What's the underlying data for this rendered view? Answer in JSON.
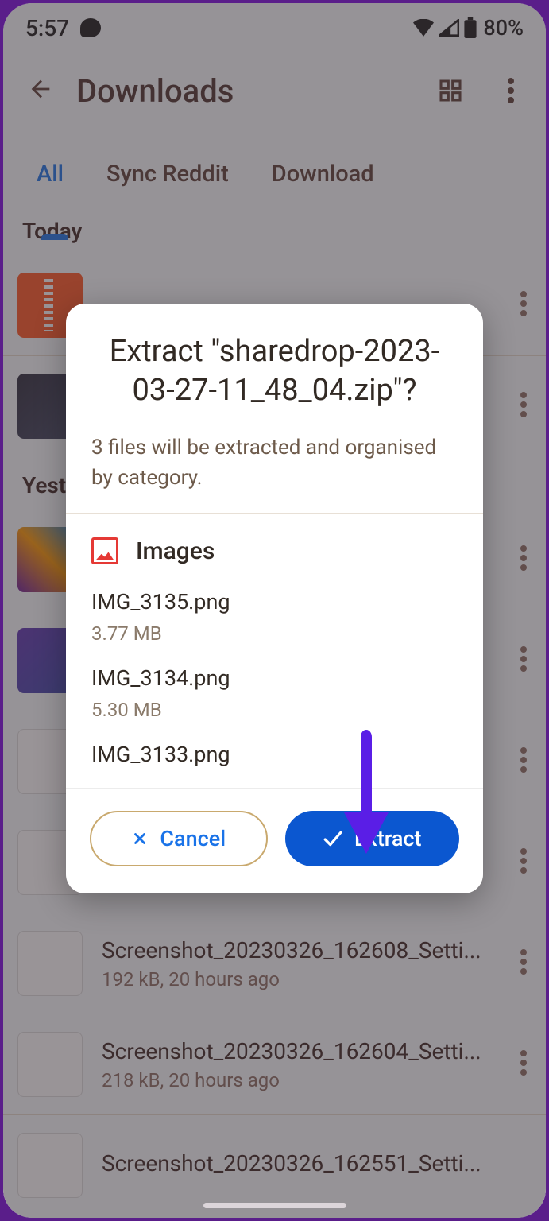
{
  "status": {
    "time": "5:57",
    "battery": "80%"
  },
  "appbar": {
    "title": "Downloads"
  },
  "tabs": {
    "all": "All",
    "sync": "Sync Reddit",
    "download": "Download"
  },
  "sections": {
    "today": "Today",
    "yesterday": "Yesterday"
  },
  "rows": {
    "r4": {
      "title": "Screenshot_20230326_162608_Setti...",
      "sub": "192 kB, 20 hours ago"
    },
    "r5": {
      "title": "Screenshot_20230326_162604_Setti...",
      "sub": "218 kB, 20 hours ago"
    },
    "r6": {
      "title": "Screenshot_20230326_162551_Setti..."
    }
  },
  "dialog": {
    "title": "Extract \"sharedrop-2023-03-27-11_48_04.zip\"?",
    "subtitle": "3 files will be extracted and organised by category.",
    "category": "Images",
    "files": [
      {
        "name": "IMG_3135.png",
        "size": "3.77 MB"
      },
      {
        "name": "IMG_3134.png",
        "size": "5.30 MB"
      },
      {
        "name": "IMG_3133.png",
        "size": ""
      }
    ],
    "cancel": "Cancel",
    "extract": "Extract"
  }
}
